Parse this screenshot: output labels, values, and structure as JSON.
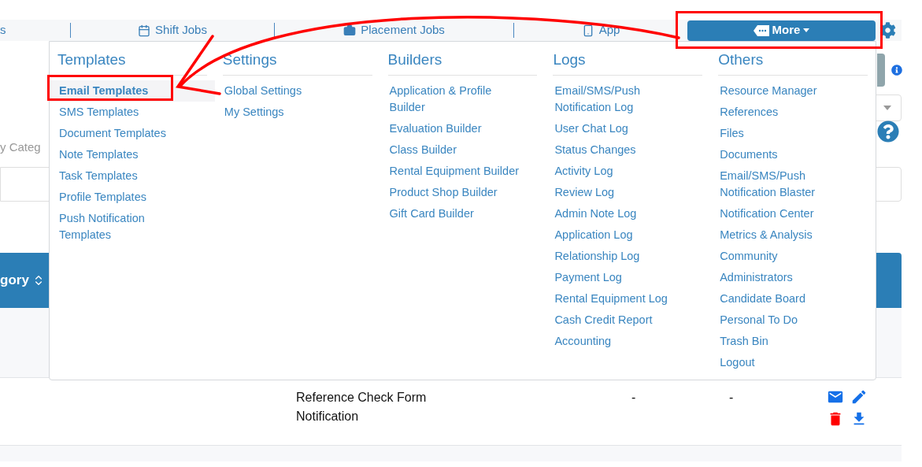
{
  "nav": {
    "items": [
      {
        "label": "s"
      },
      {
        "label": "Shift Jobs"
      },
      {
        "label": "Placement Jobs"
      },
      {
        "label": "App"
      }
    ],
    "more_button": {
      "label": "More"
    }
  },
  "menu": {
    "columns": [
      {
        "title": "Templates",
        "items": [
          {
            "label": "Email Templates",
            "selected": true
          },
          {
            "label": "SMS Templates",
            "selected": false
          },
          {
            "label": "Document Templates",
            "selected": false
          },
          {
            "label": "Note Templates",
            "selected": false
          },
          {
            "label": "Task Templates",
            "selected": false
          },
          {
            "label": "Profile Templates",
            "selected": false
          },
          {
            "label": "Push Notification Templates",
            "selected": false
          }
        ]
      },
      {
        "title": "Settings",
        "items": [
          {
            "label": "Global Settings",
            "selected": false
          },
          {
            "label": "My Settings",
            "selected": false
          }
        ]
      },
      {
        "title": "Builders",
        "items": [
          {
            "label": "Application & Profile Builder",
            "selected": false
          },
          {
            "label": "Evaluation Builder",
            "selected": false
          },
          {
            "label": "Class Builder",
            "selected": false
          },
          {
            "label": "Rental Equipment Builder",
            "selected": false
          },
          {
            "label": "Product Shop Builder",
            "selected": false
          },
          {
            "label": "Gift Card Builder",
            "selected": false
          }
        ]
      },
      {
        "title": "Logs",
        "items": [
          {
            "label": "Email/SMS/Push Notification Log",
            "selected": false
          },
          {
            "label": "User Chat Log",
            "selected": false
          },
          {
            "label": "Status Changes",
            "selected": false
          },
          {
            "label": "Activity Log",
            "selected": false
          },
          {
            "label": "Review Log",
            "selected": false
          },
          {
            "label": "Admin Note Log",
            "selected": false
          },
          {
            "label": "Application Log",
            "selected": false
          },
          {
            "label": "Relationship Log",
            "selected": false
          },
          {
            "label": "Payment Log",
            "selected": false
          },
          {
            "label": "Rental Equipment Log",
            "selected": false
          },
          {
            "label": "Cash Credit Report",
            "selected": false
          },
          {
            "label": "Accounting",
            "selected": false
          }
        ]
      },
      {
        "title": "Others",
        "items": [
          {
            "label": "Resource Manager",
            "selected": false
          },
          {
            "label": "References",
            "selected": false
          },
          {
            "label": "Files",
            "selected": false
          },
          {
            "label": "Documents",
            "selected": false
          },
          {
            "label": "Email/SMS/Push Notification Blaster",
            "selected": false
          },
          {
            "label": "Notification Center",
            "selected": false
          },
          {
            "label": "Metrics & Analysis",
            "selected": false
          },
          {
            "label": "Community",
            "selected": false
          },
          {
            "label": "Administrators",
            "selected": false
          },
          {
            "label": "Candidate Board",
            "selected": false
          },
          {
            "label": "Personal To Do",
            "selected": false
          },
          {
            "label": "Trash Bin",
            "selected": false
          },
          {
            "label": "Logout",
            "selected": false
          }
        ]
      }
    ]
  },
  "filter": {
    "placeholder": "y Categ"
  },
  "table": {
    "header": "gory",
    "row": {
      "cells": [
        "Reference Check Form Notification",
        "-",
        "-"
      ]
    }
  }
}
